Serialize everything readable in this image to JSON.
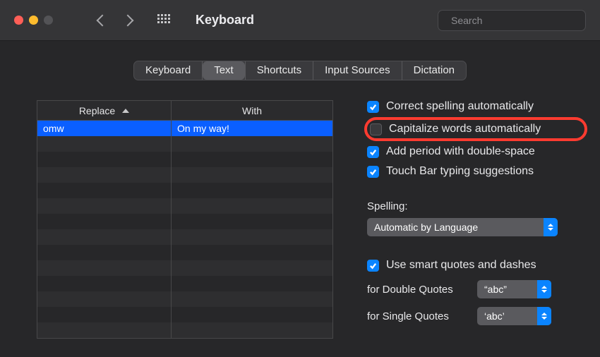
{
  "window": {
    "title": "Keyboard"
  },
  "search": {
    "placeholder": "Search"
  },
  "tabs": [
    "Keyboard",
    "Text",
    "Shortcuts",
    "Input Sources",
    "Dictation"
  ],
  "active_tab_index": 1,
  "table": {
    "columns": [
      "Replace",
      "With"
    ],
    "rows": [
      {
        "replace": "omw",
        "with": "On my way!",
        "selected": true
      }
    ]
  },
  "options": {
    "correct_spelling": {
      "label": "Correct spelling automatically",
      "checked": true
    },
    "capitalize_words": {
      "label": "Capitalize words automatically",
      "checked": false,
      "highlighted": true
    },
    "add_period": {
      "label": "Add period with double-space",
      "checked": true
    },
    "touchbar_suggestions": {
      "label": "Touch Bar typing suggestions",
      "checked": true
    }
  },
  "spelling": {
    "label": "Spelling:",
    "value": "Automatic by Language"
  },
  "smart_quotes": {
    "checkbox": {
      "label": "Use smart quotes and dashes",
      "checked": true
    },
    "double": {
      "label": "for Double Quotes",
      "value": "“abc”"
    },
    "single": {
      "label": "for Single Quotes",
      "value": "‘abc’"
    }
  }
}
